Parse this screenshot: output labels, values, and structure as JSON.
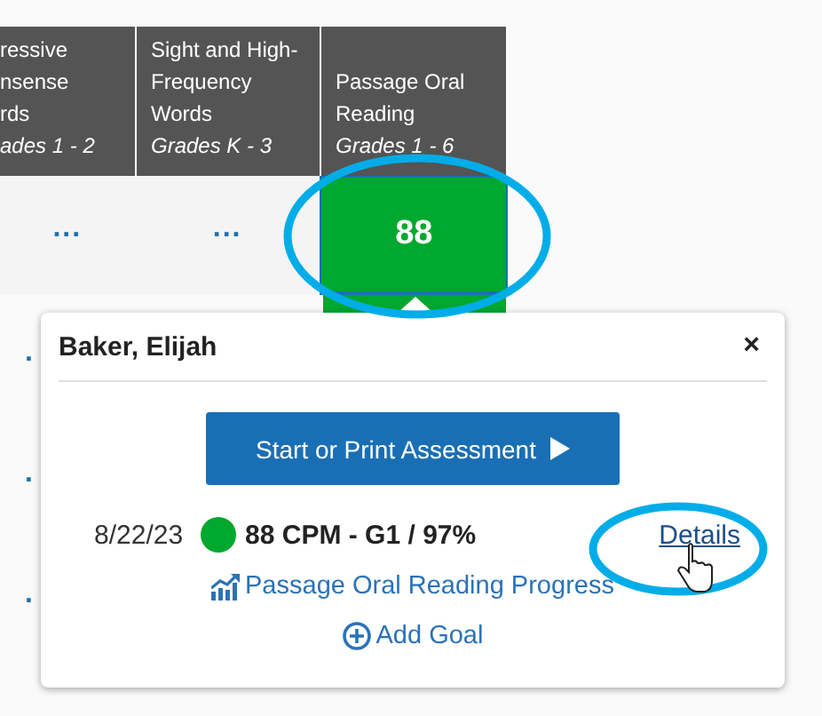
{
  "table": {
    "columns": [
      {
        "lines": [
          "ressive",
          "nsense",
          "rds"
        ],
        "grades": "ades 1 - 2"
      },
      {
        "lines": [
          "Sight and High-",
          "Frequency",
          "Words"
        ],
        "grades": "Grades K - 3"
      },
      {
        "lines": [
          "Passage Oral",
          "Reading"
        ],
        "grades": "Grades 1 - 6"
      }
    ],
    "rows": [
      {
        "cells": [
          {
            "kind": "more",
            "text": "...",
            "selected": false
          },
          {
            "kind": "more",
            "text": "...",
            "selected": false
          },
          {
            "kind": "score",
            "text": "88",
            "color": "#00a82d",
            "selected": true
          }
        ]
      }
    ],
    "hidden_rows": [
      {
        "text": "."
      },
      {
        "text": "."
      },
      {
        "text": "."
      }
    ]
  },
  "popover": {
    "student": "Baker, Elijah",
    "close": "×",
    "button": "Start or Print Assessment",
    "result": {
      "date": "8/22/23",
      "color": "#00a82d",
      "score": "88 CPM - G1 / 97%",
      "link": "Details"
    },
    "links": [
      {
        "kind": "progress",
        "text": "Passage Oral Reading Progress"
      },
      {
        "kind": "goal",
        "text": "Add Goal"
      }
    ]
  }
}
